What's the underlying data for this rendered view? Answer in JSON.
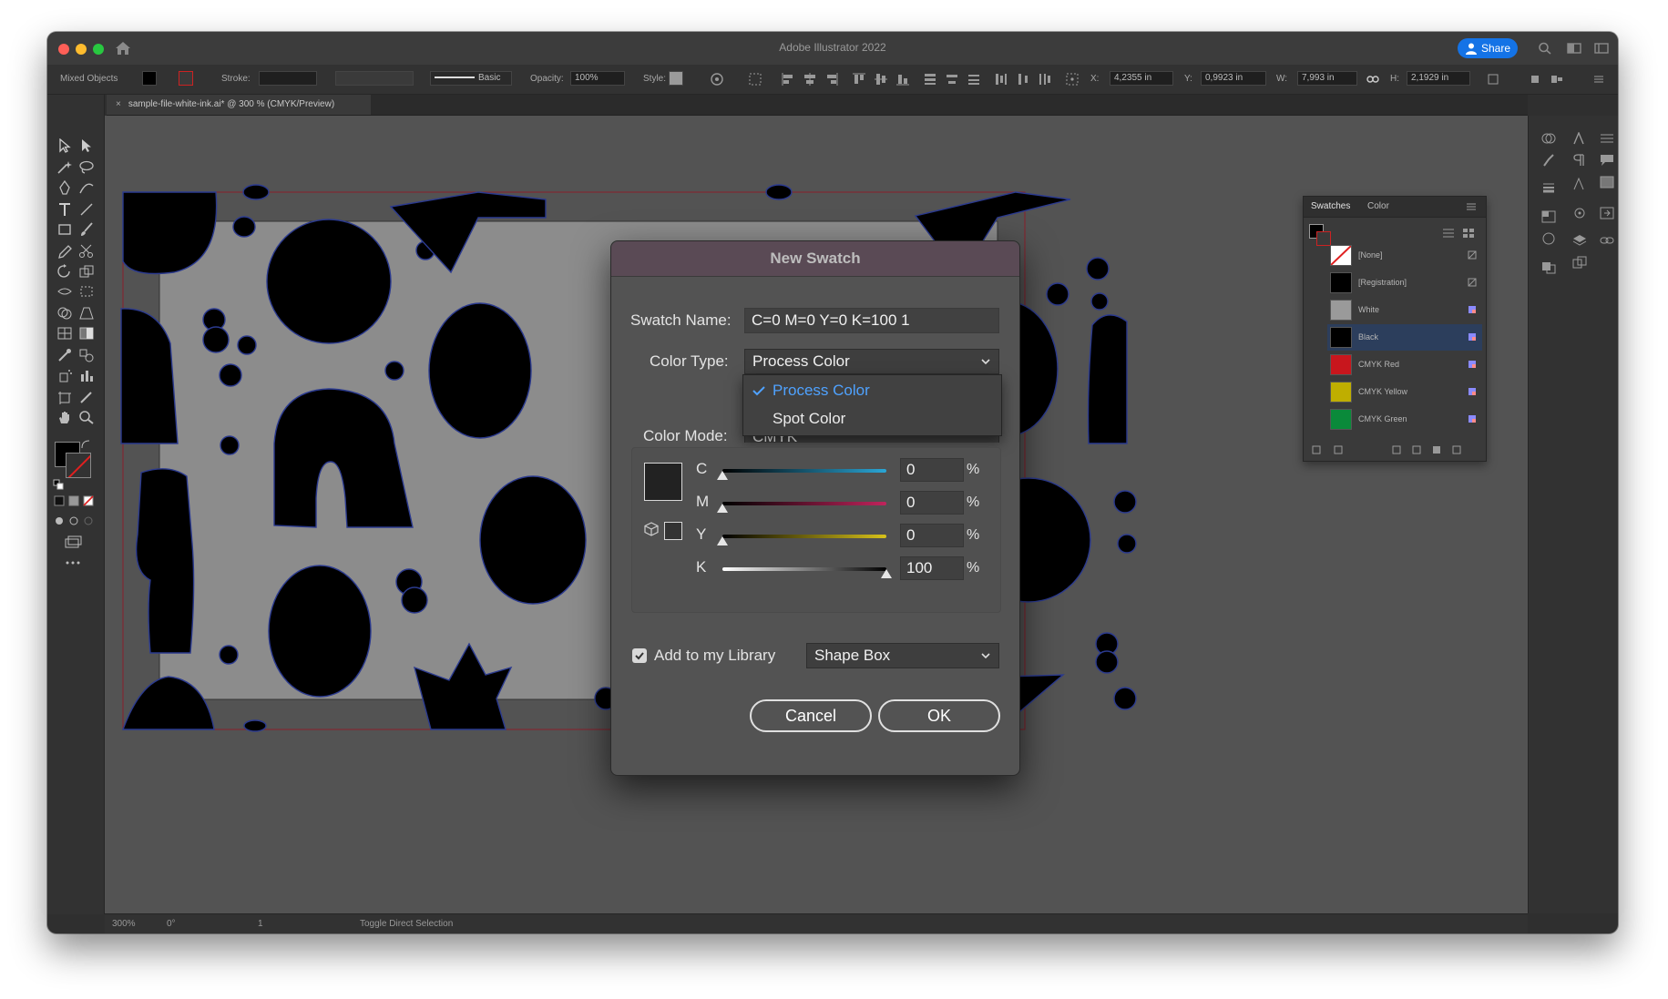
{
  "app": {
    "title": "Adobe Illustrator 2022",
    "share_label": "Share"
  },
  "control_bar": {
    "selection_label": "Mixed Objects",
    "stroke_label": "Stroke:",
    "brush_label": "Basic",
    "opacity_label": "Opacity:",
    "opacity_value": "100%",
    "style_label": "Style:",
    "x_label": "X:",
    "x_value": "4,2355 in",
    "y_label": "Y:",
    "y_value": "0,9923 in",
    "w_label": "W:",
    "w_value": "7,993 in",
    "h_label": "H:",
    "h_value": "2,1929 in"
  },
  "document": {
    "tab_close": "×",
    "tab_title": "sample-file-white-ink.ai* @ 300 % (CMYK/Preview)"
  },
  "status_bar": {
    "zoom": "300%",
    "rotation": "0°",
    "artboard": "1",
    "tool_hint": "Toggle Direct Selection"
  },
  "swatches_panel": {
    "tabs": [
      "Swatches",
      "Color"
    ],
    "items": [
      {
        "name": "[None]",
        "color": "#ffffff"
      },
      {
        "name": "[Registration]",
        "color": "#000000"
      },
      {
        "name": "White",
        "color": "#9a9a9a"
      },
      {
        "name": "Black",
        "color": "#000000"
      },
      {
        "name": "CMYK Red",
        "color": "#c8161d"
      },
      {
        "name": "CMYK Yellow",
        "color": "#bfae00"
      },
      {
        "name": "CMYK Green",
        "color": "#0a8a3a"
      }
    ]
  },
  "dialog": {
    "title": "New Swatch",
    "swatch_name_label": "Swatch Name:",
    "swatch_name_value": "C=0 M=0 Y=0 K=100 1",
    "color_type_label": "Color Type:",
    "color_type_value": "Process Color",
    "color_type_options": [
      "Process Color",
      "Spot Color"
    ],
    "color_mode_label": "Color Mode:",
    "color_mode_value": "CMYK",
    "sliders": [
      {
        "label": "C",
        "value": "0",
        "fraction": 0,
        "color": "#2aa6d6"
      },
      {
        "label": "M",
        "value": "0",
        "fraction": 0,
        "color": "#c0245c"
      },
      {
        "label": "Y",
        "value": "0",
        "fraction": 0,
        "color": "#d8c21a"
      },
      {
        "label": "K",
        "value": "100",
        "fraction": 1,
        "color": "#000000"
      }
    ],
    "percent": "%",
    "library_label": "Add to my Library",
    "library_checked": true,
    "library_value": "Shape Box",
    "cancel_label": "Cancel",
    "ok_label": "OK"
  }
}
